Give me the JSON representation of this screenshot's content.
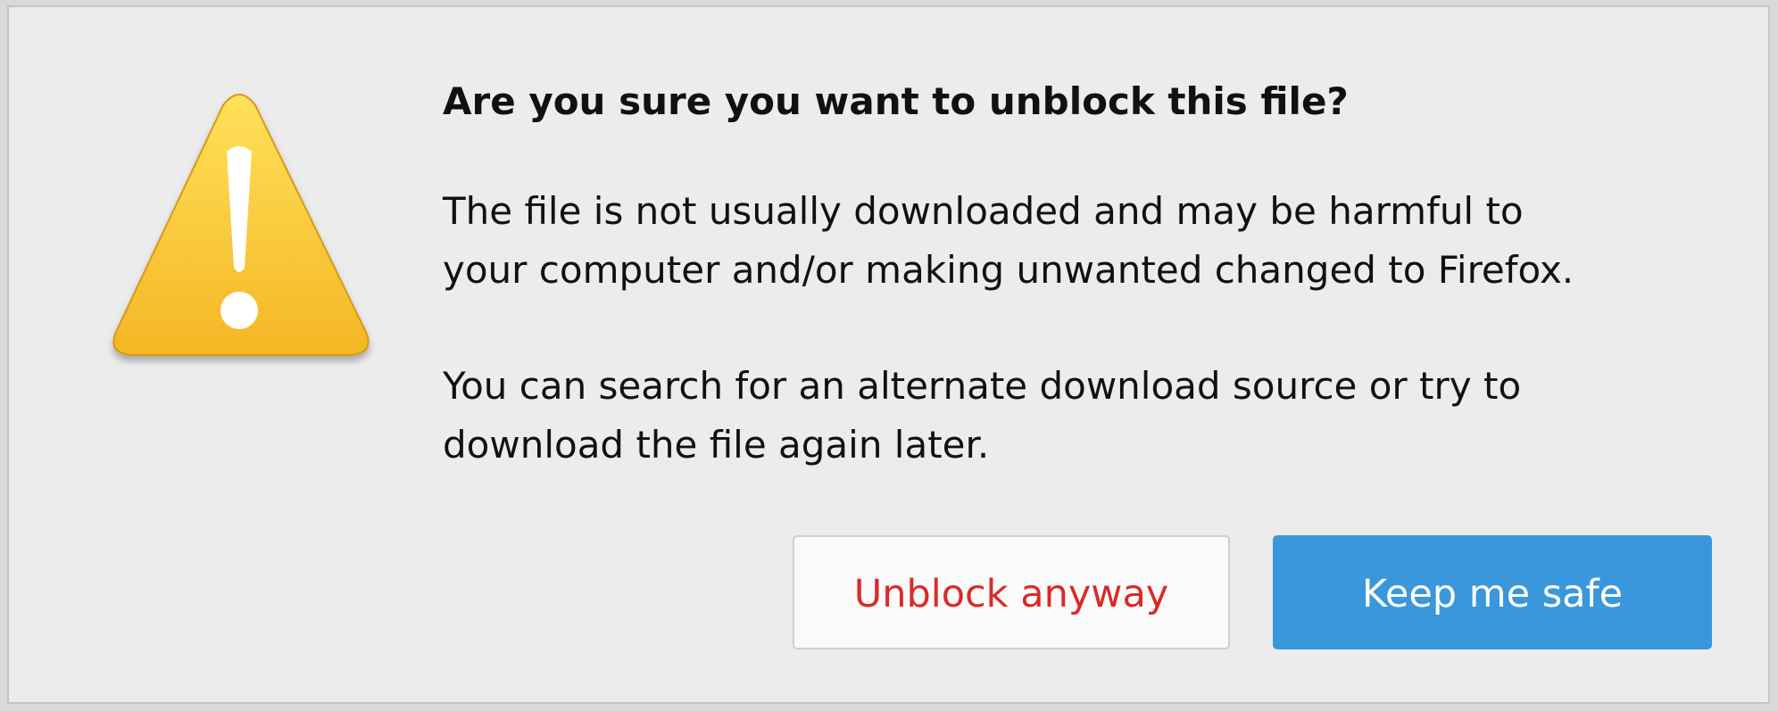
{
  "dialog": {
    "title": "Are you sure you want to unblock this file?",
    "paragraph1_line1": "The file is not usually downloaded and may be harmful to",
    "paragraph1_line2": "your computer and/or making unwanted changed to Firefox.",
    "paragraph2_line1": "You can search for an alternate download source or try to",
    "paragraph2_line2": "download the file again later.",
    "icon": "warning-triangle-icon"
  },
  "buttons": {
    "unblock_label": "Unblock anyway",
    "safe_label": "Keep me safe"
  },
  "colors": {
    "dialog_background": "#ececec",
    "warning_yellow": "#f6c02a",
    "unblock_text": "#d92b27",
    "primary_button": "#3a97db"
  }
}
